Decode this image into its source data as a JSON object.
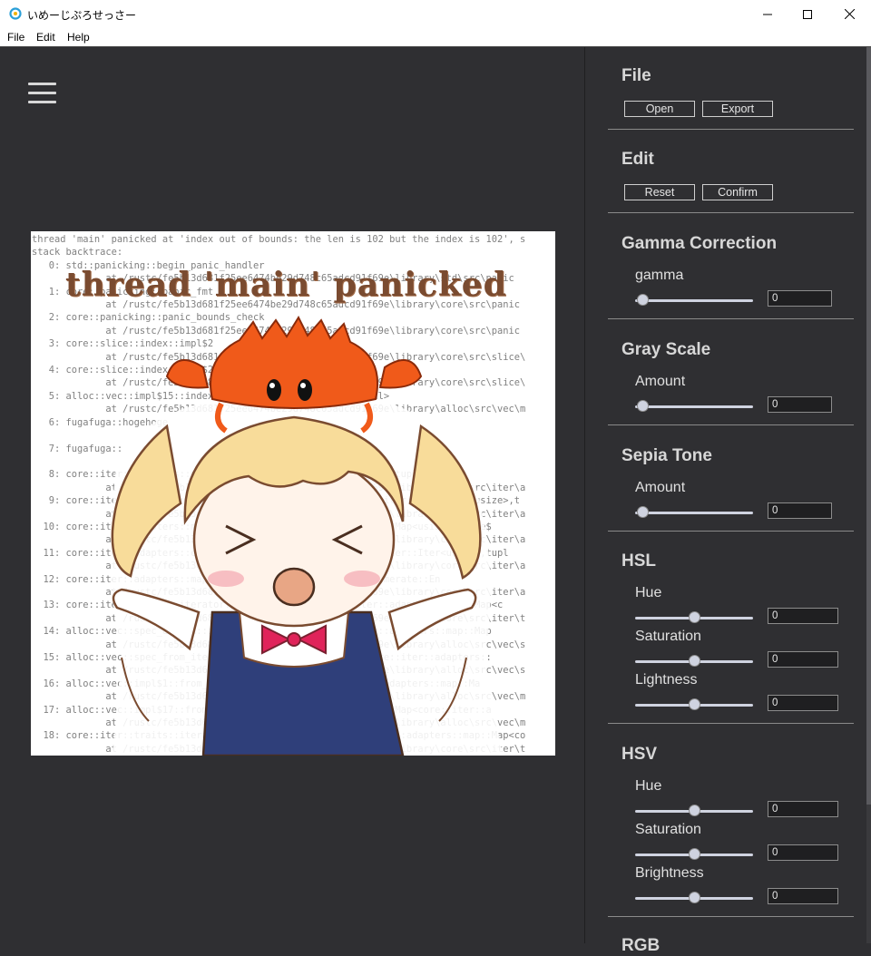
{
  "window": {
    "title": "いめーじぷろせっさー",
    "minimize_glyph": "—",
    "maximize_glyph": "☐",
    "close_glyph": "✕"
  },
  "menu": {
    "items": [
      "File",
      "Edit",
      "Help"
    ]
  },
  "image": {
    "caption": "thread 'main' panicked",
    "log_lines": [
      "thread 'main' panicked at 'index out of bounds: the len is 102 but the index is 102', s",
      "stack backtrace:",
      "   0: std::panicking::begin_panic_handler",
      "             at /rustc/fe5b13d681f25ee6474be29d748c65adcd91f69e\\library\\std\\src\\panic",
      "   1: core::panicking::panic_fmt",
      "             at /rustc/fe5b13d681f25ee6474be29d748c65adcd91f69e\\library\\core\\src\\panic",
      "   2: core::panicking::panic_bounds_check",
      "             at /rustc/fe5b13d681f25ee6474be29d748c65adcd91f69e\\library\\core\\src\\panic",
      "   3: core::slice::index::impl$2",
      "             at /rustc/fe5b13d681f25ee6474be29d748c65adcd91f69e\\library\\core\\src\\slice\\",
      "   4: core::slice::index::impl$2",
      "             at /rustc/fe5b13d681f25ee6474be29d748c65adcd91f69e\\library\\core\\src\\slice\\",
      "   5: alloc::vec::impl$15::index<u8,usize,alloc::alloc::Global>",
      "             at /rustc/fe5b13d681f25ee6474be29d748c65adcd91f69e\\library\\alloc\\src\\vec\\m",
      "   6: fugafuga::hogehoge",
      "",
      "   7: fugafuga::",
      "",
      "   8: core::iter::adapters::map::map_fold<tuple$<usize> >,usize,tuple$",
      "             at /rustc/fe5b13d681f25ee6474be29d748c65adcd91f69e\\library\\core\\src\\iter\\a",
      "   9: core::iter::adapters::enumerate::Enumerate<core::slice::iter::Iter<ref$<usize>,t",
      "             at /rustc/fe5b13d681f25ee6474be29d748c65adcd91f69e\\library\\core\\src\\iter\\a",
      "  10: core::iter::adapters::map::Map<core::iter::adapters::map::Map<usize>,tuple$",
      "             at /rustc/fe5b13d681f25ee6474be29d748c65adcd91f69e\\library\\core\\src\\iter\\a",
      "  11: core::iter::adapters::enumerate::Enumerate<core::slice::iter::Iter<usize>,tupl",
      "             at /rustc/fe5b13d681f25ee6474be29d748c65adcd91f69e\\library\\core\\src\\iter\\a",
      "  12: core::iter::adapters::map::Map<core::iter::adapters::enumerate::En",
      "             at /rustc/fe5b13d681f25ee6474be29d748c65adcd91f69e\\library\\core\\src\\iter\\a",
      "  13: core::iter::traits::iterator::Iterator::fold<core::iter::adapters::map::Map<c",
      "             at /rustc/fe5b13d681f25ee6474be29d748c65adcd91f69e\\library\\core\\src\\iter\\t",
      "  14: alloc::vec::spec_extend::impl$1::spec_extend<core::iter::adapters::map::Map",
      "             at /rustc/fe5b13d681f25ee6474be29d748c65adcd91f69e\\library\\alloc\\src\\vec\\s",
      "  15: alloc::vec::spec_from_iter_nested::impl$1::from_iter<core::iter::adapters::",
      "             at /rustc/fe5b13d681f25ee6474be29d748c65adcd91f69e\\library\\alloc\\src\\vec\\s",
      "  16: alloc::vec::impl$1::from_iter<tuple$<usize>,core::iter::adapters::map::Ma",
      "             at /rustc/fe5b13d681f25ee6474be29d748c65adcd91f69e\\library\\alloc\\src\\vec\\m",
      "  17: alloc::vec::impl$17::from_iter<core::iter::adapters::map::Map<core::iter::a",
      "             at /rustc/fe5b13d681f25ee6474be29d748c65adcd91f69e\\library\\alloc\\src\\vec\\m",
      "  18: core::iter::traits::iterator::Iterator::collect<core::iter::adapters::map::Map<co",
      "             at /rustc/fe5b13d681f25ee6474be29d748c65adcd91f69e\\library\\core\\src\\iter\\t"
    ]
  },
  "sidebar": {
    "file": {
      "title": "File",
      "open_label": "Open",
      "export_label": "Export"
    },
    "edit": {
      "title": "Edit",
      "reset_label": "Reset",
      "confirm_label": "Confirm"
    },
    "gamma": {
      "title": "Gamma Correction",
      "label": "gamma",
      "value": "0",
      "level": 0
    },
    "gray": {
      "title": "Gray Scale",
      "label": "Amount",
      "value": "0",
      "level": 0
    },
    "sepia": {
      "title": "Sepia Tone",
      "label": "Amount",
      "value": "0",
      "level": 0
    },
    "hsl": {
      "title": "HSL",
      "hue": {
        "label": "Hue",
        "value": "0",
        "level": 0.5
      },
      "saturation": {
        "label": "Saturation",
        "value": "0",
        "level": 0.5
      },
      "lightness": {
        "label": "Lightness",
        "value": "0",
        "level": 0.5
      }
    },
    "hsv": {
      "title": "HSV",
      "hue": {
        "label": "Hue",
        "value": "0",
        "level": 0.5
      },
      "saturation": {
        "label": "Saturation",
        "value": "0",
        "level": 0.5
      },
      "brightness": {
        "label": "Brightness",
        "value": "0",
        "level": 0.5
      }
    },
    "rgb": {
      "title": "RGB"
    }
  },
  "colors": {
    "background": "#2f2f32",
    "crab": "#f05a1a",
    "bow": "#e0235a",
    "dress": "#2f3f7a",
    "hair": "#f8dc9a"
  }
}
